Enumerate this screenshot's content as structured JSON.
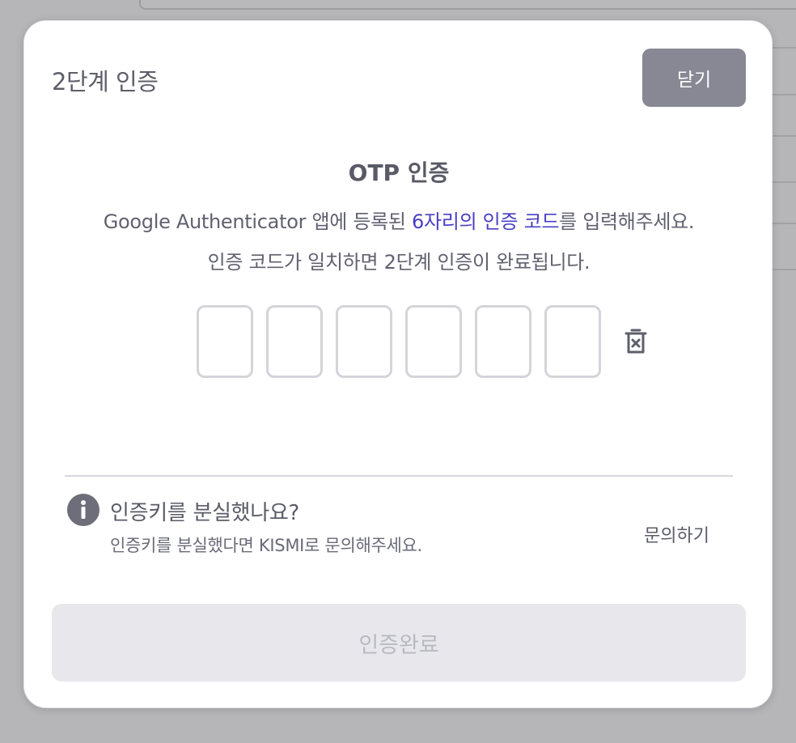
{
  "modal": {
    "title": "2단계 인증",
    "close_label": "닫기"
  },
  "otp": {
    "heading": "OTP 인증",
    "desc_line1_pre": "Google Authenticator 앱에 등록된 ",
    "desc_line1_highlight": "6자리의 인증 코드",
    "desc_line1_post": "를 입력해주세요.",
    "desc_line2": "인증 코드가 일치하면 2단계 인증이 완료됩니다.",
    "digits": [
      "",
      "",
      "",
      "",
      "",
      ""
    ],
    "clear_icon": "trash-x-icon"
  },
  "help": {
    "icon": "info-icon",
    "title": "인증키를 분실했나요?",
    "subtitle": "인증키를 분실했다면 KISMI로 문의해주세요.",
    "link_label": "문의하기"
  },
  "submit": {
    "label": "인증완료",
    "enabled": false
  },
  "colors": {
    "backdrop": "#b6b6b8",
    "highlight": "#4a3fc4",
    "close_button": "#888894",
    "submit_disabled": "#e8e8ec"
  }
}
